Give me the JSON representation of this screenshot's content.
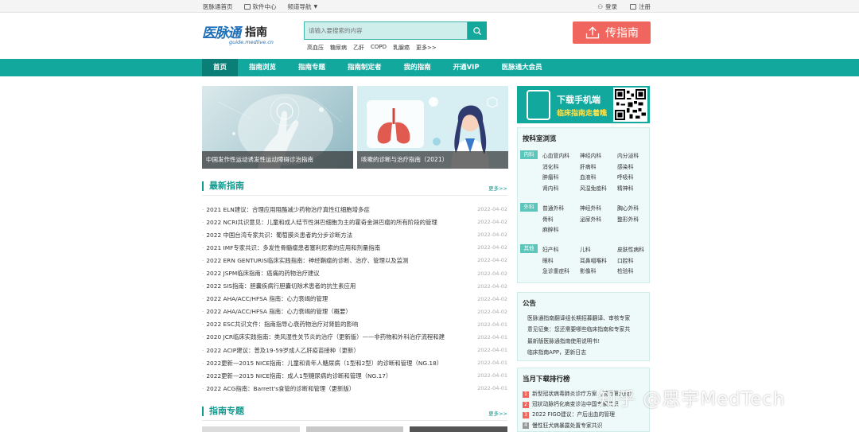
{
  "topbar": {
    "home": "医脉通首页",
    "software": "软件中心",
    "channels": "频道导航",
    "login": "登录",
    "register": "注册"
  },
  "header": {
    "logo_text": "医脉通",
    "logo_sub": "guide.medlive.cn",
    "logo_zh": "指南",
    "search_placeholder": "请输入要搜索的内容",
    "hot_keywords": [
      "高血压",
      "糖尿病",
      "乙肝",
      "COPD",
      "乳腺癌",
      "更多>>"
    ],
    "upload_label": "传指南"
  },
  "nav": {
    "items": [
      "首页",
      "指南浏览",
      "指南专题",
      "指南制定者",
      "我的指南",
      "开通VIP",
      "医脉通大会员"
    ]
  },
  "banners": [
    {
      "caption": "中国发作性运动诱发性运动障碍诊治指南"
    },
    {
      "caption": "咳嗽的诊断与治疗指南（2021）"
    }
  ],
  "latest": {
    "title": "最新指南",
    "more": "更多>>",
    "items": [
      {
        "text": "2021 ELN建议：合理应用阻酪减少药物治疗真性红细胞增多症",
        "date": "2022-04-02"
      },
      {
        "text": "2022 NCRI共识意见：儿童和成人结节性淋巴细胞为主的霍奇金淋巴瘤的所有阶段的管理",
        "date": "2022-04-02"
      },
      {
        "text": "2022 中国台湾专家共识：葡萄膜炎患者的分步诊断方法",
        "date": "2022-04-02"
      },
      {
        "text": "2021 IMF专家共识：多发性骨髓瘤患者塞利尼索的应用和剂量指南",
        "date": "2022-04-02"
      },
      {
        "text": "2022 ERN GENTURIS临床实践指南：神经鞘瘤的诊断、治疗、管理以及监测",
        "date": "2022-04-02"
      },
      {
        "text": "2022 JSPM临床指南：癌痛的药物治疗建议",
        "date": "2022-04-02"
      },
      {
        "text": "2022 SIS指南：胆囊疾病行胆囊切除术患者的抗生素应用",
        "date": "2022-04-02"
      },
      {
        "text": "2022 AHA/ACC/HFSA 指南：心力衰竭的管理",
        "date": "2022-04-02"
      },
      {
        "text": "2022 AHA/ACC/HFSA 指南：心力衰竭的管理（概要）",
        "date": "2022-04-02"
      },
      {
        "text": "2022 ESC共识文件：指南指导心衰药物治疗对肾脏的影响",
        "date": "2022-04-01"
      },
      {
        "text": "2020 JCR临床实践指南：类风湿性关节炎的治疗（更新版）——非药物和外科治疗流程和建",
        "date": "2022-04-01"
      },
      {
        "text": "2022 ACIP建议：普及19-59岁成人乙肝疫苗接种（更新）",
        "date": "2022-04-01"
      },
      {
        "text": "2022更新—2015 NICE指南：儿童和青年人糖尿病（1型和2型）的诊断和管理（NG.18）",
        "date": "2022-04-01"
      },
      {
        "text": "2022更新—2015 NICE指南：成人1型糖尿病的诊断和管理（NG.17）",
        "date": "2022-04-01"
      },
      {
        "text": "2022 ACG指南：Barrett's食管的诊断和管理（更新版）",
        "date": "2022-04-01"
      }
    ]
  },
  "topics": {
    "title": "指南专题",
    "more": "更多>>"
  },
  "app_banner": {
    "line1": "下载手机端",
    "line2": "临床指南走着瞧"
  },
  "departments": {
    "title": "按科室浏览",
    "groups": [
      {
        "tag": "内科",
        "items": [
          "心血管内科",
          "神经内科",
          "内分泌科",
          "消化科",
          "肝病科",
          "感染科",
          "肿瘤科",
          "血液科",
          "呼吸科",
          "肾内科",
          "风湿免疫科",
          "精神科"
        ]
      },
      {
        "tag": "外科",
        "items": [
          "普通外科",
          "神经外科",
          "胸心外科",
          "骨科",
          "泌尿外科",
          "整形外科",
          "麻醉科"
        ]
      },
      {
        "tag": "其他",
        "items": [
          "妇产科",
          "儿科",
          "皮肤性病科",
          "眼科",
          "耳鼻咽喉科",
          "口腔科",
          "急诊重症科",
          "影像科",
          "检验科"
        ]
      }
    ]
  },
  "notice": {
    "title": "公告",
    "items": [
      "医脉通指南翻译组长期招募翻译、审核专家",
      "意见征集：您还需要哪些临床指南和专家共",
      "最新版医脉通指南使用说明书!",
      "临床指南APP，更新日志"
    ]
  },
  "ranking": {
    "title": "当月下载排行榜",
    "items": [
      "新型冠状病毒肺炎诊疗方案（试行第九版）",
      "冠状动脉钙化病变诊治中国专家共识",
      "2022 FIGO建议：产后出血的管理",
      "慢性狂犬病暴露处置专家共识"
    ]
  },
  "watermark": "知乎 @思宇MedTech"
}
